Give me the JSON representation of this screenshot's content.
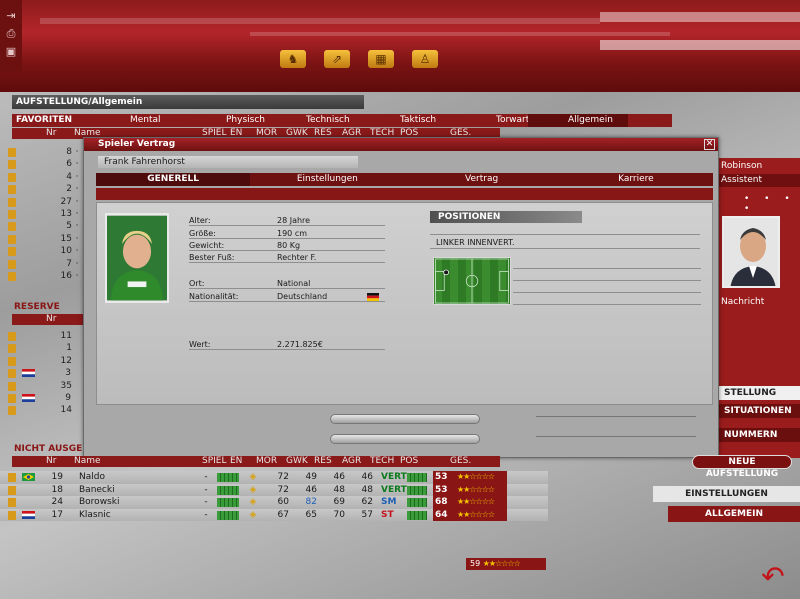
{
  "app": {
    "page_title": "AUFSTELLUNG/Allgemein",
    "left_tools": [
      "exit-icon",
      "printer-icon",
      "disk-icon"
    ],
    "top_icons": [
      "team-icon",
      "tactics-icon",
      "stadium-icon",
      "training-icon"
    ]
  },
  "categories": {
    "favorites": "FAVORITEN",
    "items": [
      "Mental",
      "Physisch",
      "Technisch",
      "Taktisch",
      "Torwart",
      "Allgemein"
    ]
  },
  "columns": {
    "nr": "Nr",
    "name": "Name",
    "spiel": "SPIEL",
    "en": "EN",
    "mor": "MOR",
    "gwk": "GWK",
    "res": "RES",
    "agr": "AGR",
    "tech": "TECH",
    "pos": "POS",
    "ges": "GES."
  },
  "favorites_rows": [
    {
      "nr": "8",
      "dot": "·"
    },
    {
      "nr": "6",
      "dot": "·"
    },
    {
      "nr": "4",
      "dot": "·"
    },
    {
      "nr": "2",
      "dot": "·"
    },
    {
      "nr": "27",
      "dot": "·"
    },
    {
      "nr": "13",
      "dot": "·"
    },
    {
      "nr": "5",
      "dot": "·"
    },
    {
      "nr": "15",
      "dot": "·"
    },
    {
      "nr": "10",
      "dot": "·"
    },
    {
      "nr": "7",
      "dot": "·"
    },
    {
      "nr": "16",
      "dot": "·"
    }
  ],
  "reserve": {
    "label": "RESERVE",
    "rows": [
      {
        "nr": "11",
        "flag": ""
      },
      {
        "nr": "1",
        "flag": ""
      },
      {
        "nr": "12",
        "flag": ""
      },
      {
        "nr": "3",
        "flag": "hr"
      },
      {
        "nr": "35",
        "flag": ""
      },
      {
        "nr": "9",
        "flag": "hr"
      },
      {
        "nr": "14",
        "flag": ""
      }
    ]
  },
  "dialog": {
    "title": "Spieler Vertrag",
    "player_name": "Frank Fahrenhorst",
    "tabs": [
      "GENERELL",
      "Einstellungen",
      "Vertrag",
      "Karriere"
    ],
    "info": {
      "alter_label": "Alter:",
      "alter": "28 Jahre",
      "groesse_label": "Größe:",
      "groesse": "190 cm",
      "gewicht_label": "Gewicht:",
      "gewicht": "80 Kg",
      "fuss_label": "Bester Fuß:",
      "fuss": "Rechter F.",
      "ort_label": "Ort:",
      "ort": "National",
      "nat_label": "Nationalität:",
      "nat": "Deutschland",
      "wert_label": "Wert:",
      "wert": "2.271.825€"
    },
    "positions_label": "POSITIONEN",
    "position": "LINKER INNENVERT."
  },
  "right": {
    "coach_name": "Robinson",
    "coach_role": "Assistent",
    "news": "Nachricht",
    "menu": [
      "STELLUNG",
      "SITUATIONEN",
      "NUMMERN"
    ],
    "neue": "NEUE AUFSTELLUNG",
    "einstellungen": "EINSTELLUNGEN",
    "allgemein": "ALLGEMEIN"
  },
  "not_selected": {
    "label": "NICHT AUSGE",
    "rows": [
      {
        "nr": "19",
        "flag": "br",
        "name": "Naldo",
        "spiel": "-",
        "mor": "72",
        "gwk": "49",
        "res": "46",
        "agr": "46",
        "pos": "VERT",
        "pos_color": "#0c7a1c",
        "ges": "53",
        "stars": "★★☆☆☆☆"
      },
      {
        "nr": "18",
        "flag": "",
        "name": "Banecki",
        "spiel": "-",
        "mor": "72",
        "gwk": "46",
        "res": "48",
        "agr": "48",
        "pos": "VERT",
        "pos_color": "#0c7a1c",
        "ges": "53",
        "stars": "★★☆☆☆☆"
      },
      {
        "nr": "24",
        "flag": "",
        "name": "Borowski",
        "spiel": "-",
        "mor": "60",
        "gwk": "82",
        "res": "69",
        "agr": "62",
        "pos": "SM",
        "pos_color": "#1d5fb5",
        "ges": "68",
        "stars": "★★☆☆☆☆"
      },
      {
        "nr": "17",
        "flag": "hr",
        "name": "Klasnic",
        "spiel": "-",
        "mor": "67",
        "gwk": "65",
        "res": "70",
        "agr": "57",
        "pos": "ST",
        "pos_color": "#c4121a",
        "ges": "64",
        "stars": "★★☆☆☆☆"
      }
    ],
    "extra_score": "59"
  },
  "colors": {
    "accent": "#8a1919",
    "dark_red": "#6d1111",
    "pitch": "#3b8c2f"
  }
}
